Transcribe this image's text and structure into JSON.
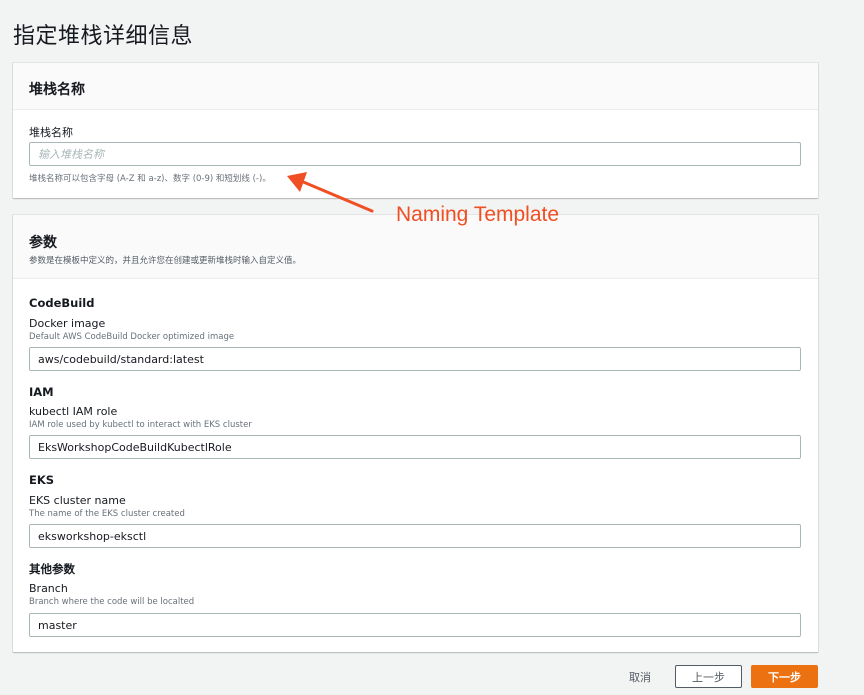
{
  "page": {
    "title": "指定堆栈详细信息"
  },
  "stack_name_panel": {
    "header": "堆栈名称",
    "label": "堆栈名称",
    "placeholder": "输入堆栈名称",
    "value": "",
    "hint": "堆栈名称可以包含字母 (A-Z 和 a-z)、数字 (0-9) 和短划线 (-)。"
  },
  "parameters_panel": {
    "header": "参数",
    "description": "参数是在模板中定义的，并且允许您在创建或更新堆栈时输入自定义值。",
    "groups": [
      {
        "title": "CodeBuild",
        "label": "Docker image",
        "description": "Default AWS CodeBuild Docker optimized image",
        "value": "aws/codebuild/standard:latest"
      },
      {
        "title": "IAM",
        "label": "kubectl IAM role",
        "description": "IAM role used by kubectl to interact with EKS cluster",
        "value": "EksWorkshopCodeBuildKubectlRole"
      },
      {
        "title": "EKS",
        "label": "EKS cluster name",
        "description": "The name of the EKS cluster created",
        "value": "eksworkshop-eksctl"
      },
      {
        "title": "其他参数",
        "label": "Branch",
        "description": "Branch where the code will be localted",
        "value": "master"
      }
    ]
  },
  "actions": {
    "cancel": "取消",
    "previous": "上一步",
    "next": "下一步"
  },
  "annotation": {
    "text": "Naming Template",
    "color": "#f04e23"
  },
  "colors": {
    "primary_button": "#ec7211",
    "background": "#f2f3f3"
  }
}
